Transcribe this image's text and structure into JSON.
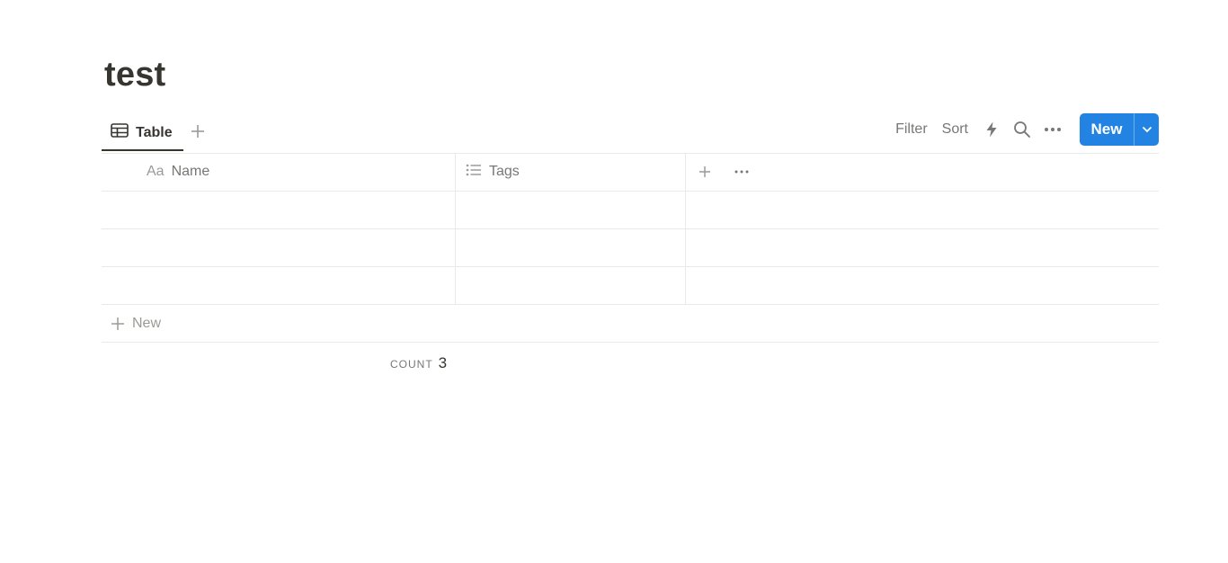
{
  "page": {
    "title": "test"
  },
  "view": {
    "tab_label": "Table",
    "tab_icon": "table-icon"
  },
  "toolbar": {
    "filter_label": "Filter",
    "sort_label": "Sort",
    "automation_icon": "lightning-icon",
    "search_icon": "search-icon",
    "more_icon": "more-horizontal-icon",
    "new_label": "New"
  },
  "table": {
    "columns": [
      {
        "label": "Name",
        "type_glyph": "Aa"
      },
      {
        "label": "Tags",
        "type_glyph": "list-icon"
      }
    ],
    "rows": [
      {
        "name": "",
        "tags": ""
      },
      {
        "name": "",
        "tags": ""
      },
      {
        "name": "",
        "tags": ""
      }
    ],
    "new_row_label": "New",
    "count_label": "COUNT",
    "count_value": "3"
  },
  "colors": {
    "accent": "#2383e2",
    "text": "#37352f",
    "muted": "#787774",
    "border": "#e9e9e7"
  }
}
